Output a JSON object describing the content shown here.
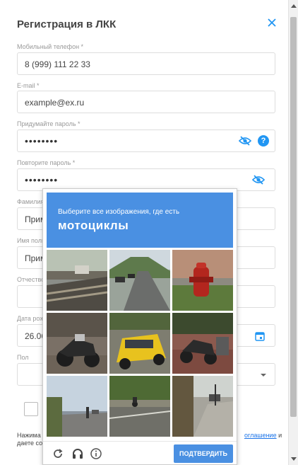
{
  "modal": {
    "title": "Регистрация в ЛКК",
    "close_icon": "close-icon"
  },
  "form": {
    "phone": {
      "label": "Мобильный телефон *",
      "value": "8 (999) 111 22 33"
    },
    "email": {
      "label": "E-mail *",
      "value": "example@ex.ru"
    },
    "password": {
      "label": "Придумайте пароль *",
      "value": "••••••••",
      "help": "?"
    },
    "password_repeat": {
      "label": "Повторите пароль *",
      "value": "••••••••"
    },
    "lastname": {
      "label": "Фамилия",
      "value_partial": "Прим"
    },
    "firstname": {
      "label": "Имя поль",
      "value_partial": "Прим"
    },
    "patronymic": {
      "label": "Отчество",
      "value_partial": ""
    },
    "birthdate": {
      "label": "Дата рож",
      "value_partial": "26.06"
    },
    "gender": {
      "label": "Пол",
      "value_partial": ""
    },
    "consent": {
      "text_left_1": "Нажима",
      "text_left_2": "даете со",
      "link_text": "оглашение",
      "text_after_link": " и"
    }
  },
  "captcha": {
    "instruction": "Выберите все изображения, где есть",
    "object": "мотоциклы",
    "verify_label": "ПОДТВЕРДИТЬ",
    "icons": [
      "reload-icon",
      "headphones-icon",
      "info-icon"
    ],
    "colors": {
      "header": "#4a90e2",
      "button": "#4a90e2"
    }
  },
  "colors": {
    "accent": "#2196f3"
  }
}
